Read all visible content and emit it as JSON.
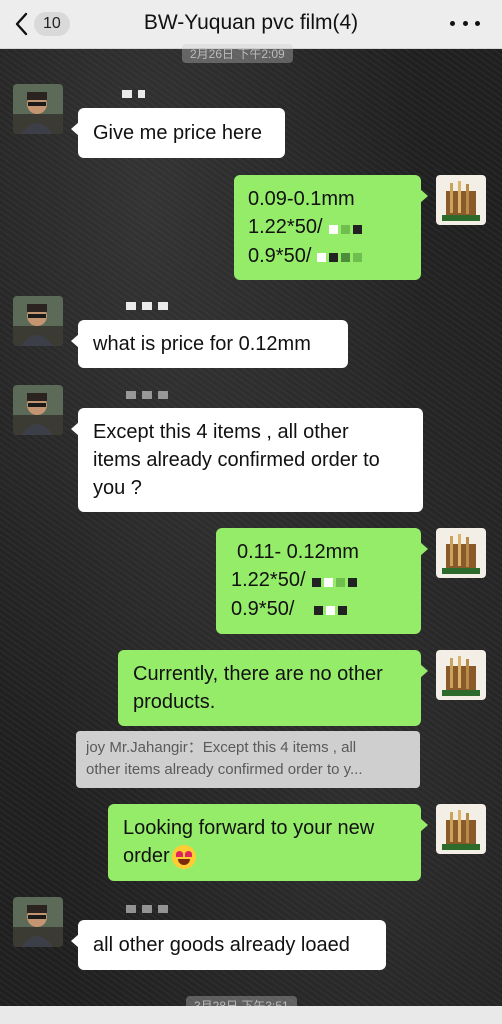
{
  "header": {
    "back_count": "10",
    "title": "BW-Yuquan pvc film(4)"
  },
  "timestamps": {
    "top": "2月26日 下午2:09",
    "bottom": "3月28日 下午3:51"
  },
  "messages": [
    {
      "side": "in",
      "lines": [
        "Give me price here"
      ]
    },
    {
      "side": "out",
      "lines": [
        "0.09-0.1mm",
        "1.22*50/",
        "0.9*50/"
      ]
    },
    {
      "side": "in",
      "lines": [
        "what is price for 0.12mm"
      ]
    },
    {
      "side": "in",
      "lines": [
        "Except this 4 items , all other",
        "items already confirmed order to",
        "you ?"
      ]
    },
    {
      "side": "out",
      "lines": [
        "0.11- 0.12mm",
        "1.22*50/",
        "0.9*50/"
      ]
    },
    {
      "side": "out",
      "lines": [
        "Currently, there are no other",
        "products."
      ]
    },
    {
      "side": "out",
      "lines": [
        "Looking forward to your new",
        "order"
      ]
    },
    {
      "side": "in",
      "lines": [
        "all other goods already loaed"
      ]
    }
  ],
  "quote": {
    "line1": "joy Mr.Jahangir：Except this 4 items , all",
    "line2": "other items already confirmed order to y..."
  },
  "colors": {
    "outgoing_bubble": "#95ec69",
    "incoming_bubble": "#ffffff",
    "header_bg": "#ededed"
  },
  "icons": {
    "back": "chevron-left-icon",
    "more": "more-dots-icon",
    "emoji": "heart-eyes-emoji"
  }
}
